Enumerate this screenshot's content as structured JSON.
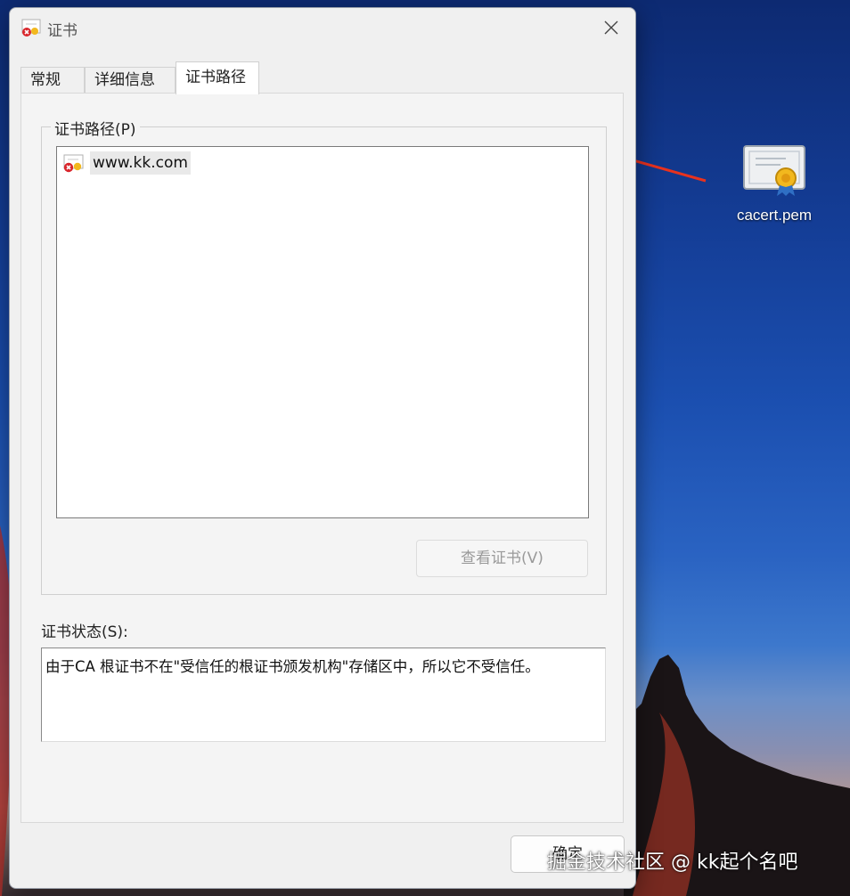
{
  "dialog": {
    "title": "证书",
    "tabs": [
      "常规",
      "详细信息",
      "证书路径"
    ],
    "active_tab": "证书路径",
    "path_group_label": "证书路径(P)",
    "tree_items": [
      {
        "label": "www.kk.com",
        "status": "untrusted"
      }
    ],
    "view_cert_button": "查看证书(V)",
    "status_label": "证书状态(S):",
    "status_text": "由于CA 根证书不在\"受信任的根证书颁发机构\"存储区中，所以它不受信任。",
    "ok_button": "确定"
  },
  "desktop": {
    "icon_label": "cacert.pem"
  },
  "watermark": "掘金技术社区 @ kk起个名吧",
  "colors": {
    "arrow": "#e8321e",
    "dialog_bg": "#f0f0f0",
    "wallpaper_top": "#0d2a72"
  }
}
